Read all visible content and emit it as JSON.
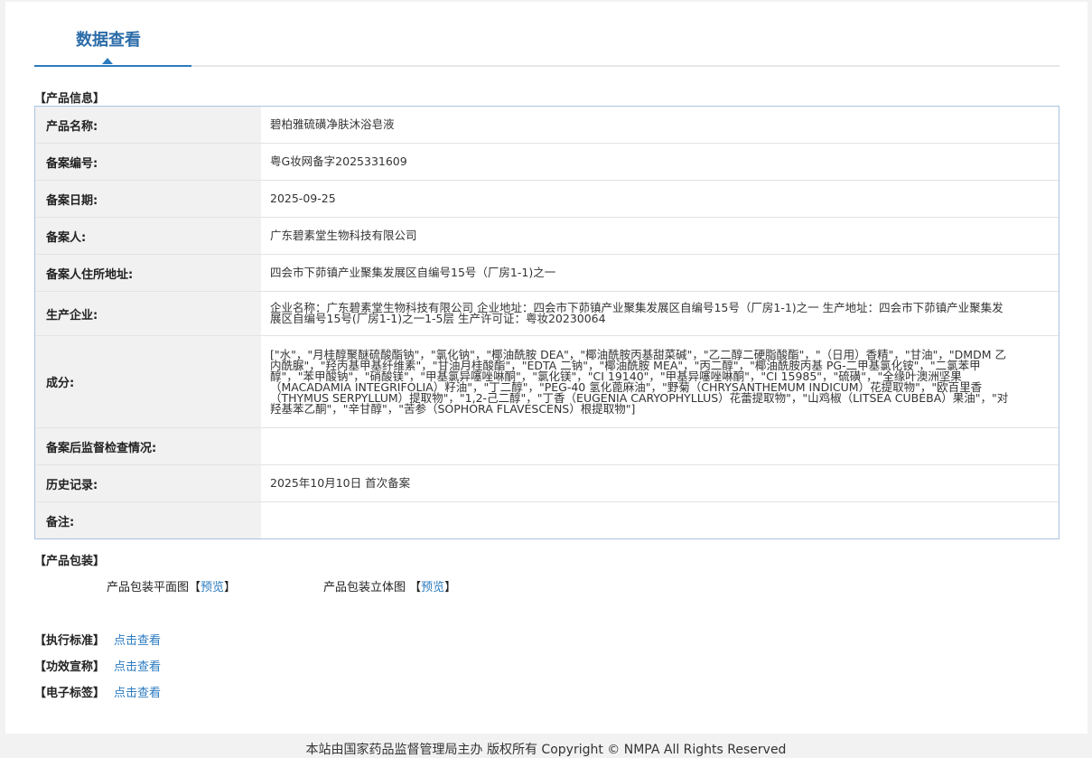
{
  "tab": {
    "label": "数据查看"
  },
  "product_info": {
    "section_title": "【产品信息】",
    "rows": [
      {
        "label": "产品名称:",
        "value": "碧柏雅硫磺净肤沐浴皂液"
      },
      {
        "label": "备案编号:",
        "value": "粤G妆网备字2025331609"
      },
      {
        "label": "备案日期:",
        "value": "2025-09-25"
      },
      {
        "label": "备案人:",
        "value": "广东碧素堂生物科技有限公司"
      },
      {
        "label": "备案人住所地址:",
        "value": "四会市下茆镇产业聚集发展区自编号15号（厂房1-1)之一"
      },
      {
        "label": "生产企业:",
        "value": "企业名称：广东碧素堂生物科技有限公司 企业地址：四会市下茆镇产业聚集发展区自编号15号（厂房1-1)之一 生产地址：四会市下茆镇产业聚集发展区自编号15号(厂房1-1)之一1-5层 生产许可证：粤妆20230064"
      },
      {
        "label": "成分:",
        "value": "[\"水\"，\"月桂醇聚醚硫酸酯钠\"，\"氯化钠\"，\"椰油酰胺 DEA\"，\"椰油酰胺丙基甜菜碱\"，\"乙二醇二硬脂酸酯\"，\"（日用）香精\"，\"甘油\"，\"DMDM 乙内酰脲\"，\"羟丙基甲基纤维素\"，\"甘油月桂酸酯\"，\"EDTA 二钠\"，\"椰油酰胺 MEA\"，\"丙二醇\"，\"椰油酰胺丙基 PG-二甲基氯化铵\"，\"二氯苯甲醇\"，\"苯甲酸钠\"，\"硝酸镁\"，\"甲基氯异噻唑啉酮\"，\"氯化镁\"，\"CI 19140\"，\"甲基异噻唑啉酮\"，\"CI 15985\"，\"硫磺\"，\"全缘叶澳洲坚果（MACADAMIA INTEGRIFOLIA）籽油\"，\"丁二醇\"，\"PEG-40 氢化蓖麻油\"，\"野菊（CHRYSANTHEMUM INDICUM）花提取物\"，\"欧百里香（THYMUS SERPYLLUM）提取物\"，\"1,2-己二醇\"，\"丁香（EUGENIA CARYOPHYLLUS）花蕾提取物\"，\"山鸡椒（LITSEA CUBEBA）果油\"，\"对羟基苯乙酮\"，\"辛甘醇\"，\"苦参（SOPHORA FLAVESCENS）根提取物\"]"
      },
      {
        "label": "备案后监督检查情况:",
        "value": ""
      },
      {
        "label": "历史记录:",
        "value": "2025年10月10日 首次备案"
      },
      {
        "label": "备注:",
        "value": ""
      }
    ]
  },
  "packaging": {
    "section_title": "【产品包装】",
    "flat_label": "产品包装平面图",
    "flat_open": "【",
    "flat_link": "预览",
    "flat_close": "】",
    "three_d_label": "产品包装立体图 ",
    "three_d_open": "【",
    "three_d_link": "预览",
    "three_d_close": "】"
  },
  "standards": [
    {
      "label": "【执行标准】",
      "link": "点击查看"
    },
    {
      "label": "【功效宣称】",
      "link": "点击查看"
    },
    {
      "label": "【电子标签】",
      "link": "点击查看"
    }
  ],
  "footer": {
    "text": "本站由国家药品监督管理局主办 版权所有 Copyright © NMPA All Rights Reserved"
  }
}
